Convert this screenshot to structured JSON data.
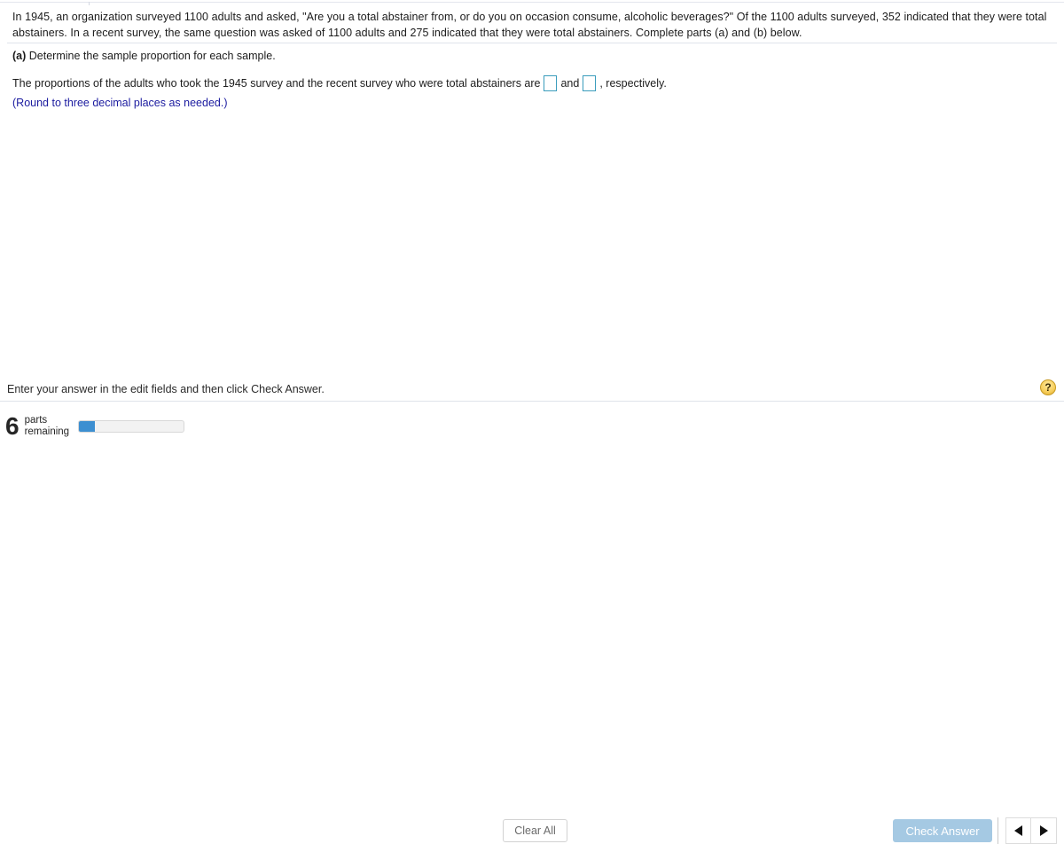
{
  "question": {
    "text": "In 1945, an organization surveyed 1100 adults and asked, \"Are you a total abstainer from, or do you on occasion consume, alcoholic beverages?\" Of the 1100 adults surveyed, 352 indicated that they were total abstainers. In a recent survey, the same question was asked of 1100 adults and 275 indicated that they were total abstainers. Complete parts (a) and (b) below."
  },
  "part_a": {
    "marker": "(a)",
    "prompt": "Determine the sample proportion for each sample.",
    "answer_prefix": "The proportions of the adults who took the 1945 survey and the recent survey who were total abstainers are",
    "answer_mid": "and",
    "answer_suffix": ", respectively.",
    "box1_value": "",
    "box2_value": "",
    "rounding_note": "(Round to three decimal places as needed.)"
  },
  "footer": {
    "status_text": "Enter your answer in the edit fields and then click Check Answer.",
    "help_label": "?",
    "parts_count": "6",
    "parts_label_line1": "parts",
    "parts_label_line2": "remaining",
    "progress_percent": 15,
    "clear_label": "Clear All",
    "check_label": "Check Answer"
  },
  "colors": {
    "accent_blue": "#3d8fd1",
    "check_button": "#a5c9e3",
    "input_border": "#3a9cbc",
    "note_blue": "#1c1ca0",
    "help_yellow": "#f7cf5e",
    "divider": "#dfe3eb"
  }
}
